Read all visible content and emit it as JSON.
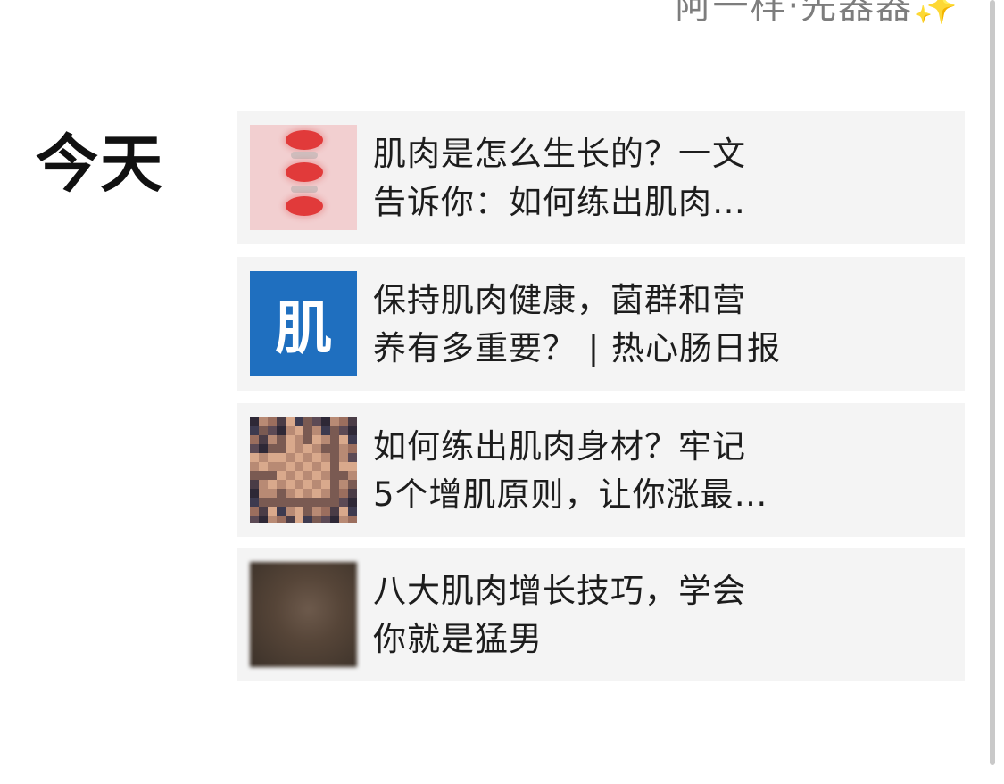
{
  "top_partial_text": "阿一样·先器器✨",
  "section": {
    "title": "今天"
  },
  "articles": [
    {
      "title": "肌肉是怎么生长的？一文\n告诉你：如何练出肌肉…",
      "thumbnail": "red-discs-illustration"
    },
    {
      "title": "保持肌肉健康，菌群和营\n养有多重要？ | 热心肠日报",
      "thumbnail": "blue-logo",
      "thumbnail_text": "肌"
    },
    {
      "title": "如何练出肌肉身材？牢记\n5个增肌原则，让你涨最…",
      "thumbnail": "pixelated-muscle-photo"
    },
    {
      "title": "八大肌肉增长技巧，学会\n你就是猛男",
      "thumbnail": "blurred-photo"
    }
  ],
  "colors": {
    "card_background": "#f4f4f4",
    "logo_blue": "#1f6fbf",
    "disc_red": "#e13a3a"
  }
}
